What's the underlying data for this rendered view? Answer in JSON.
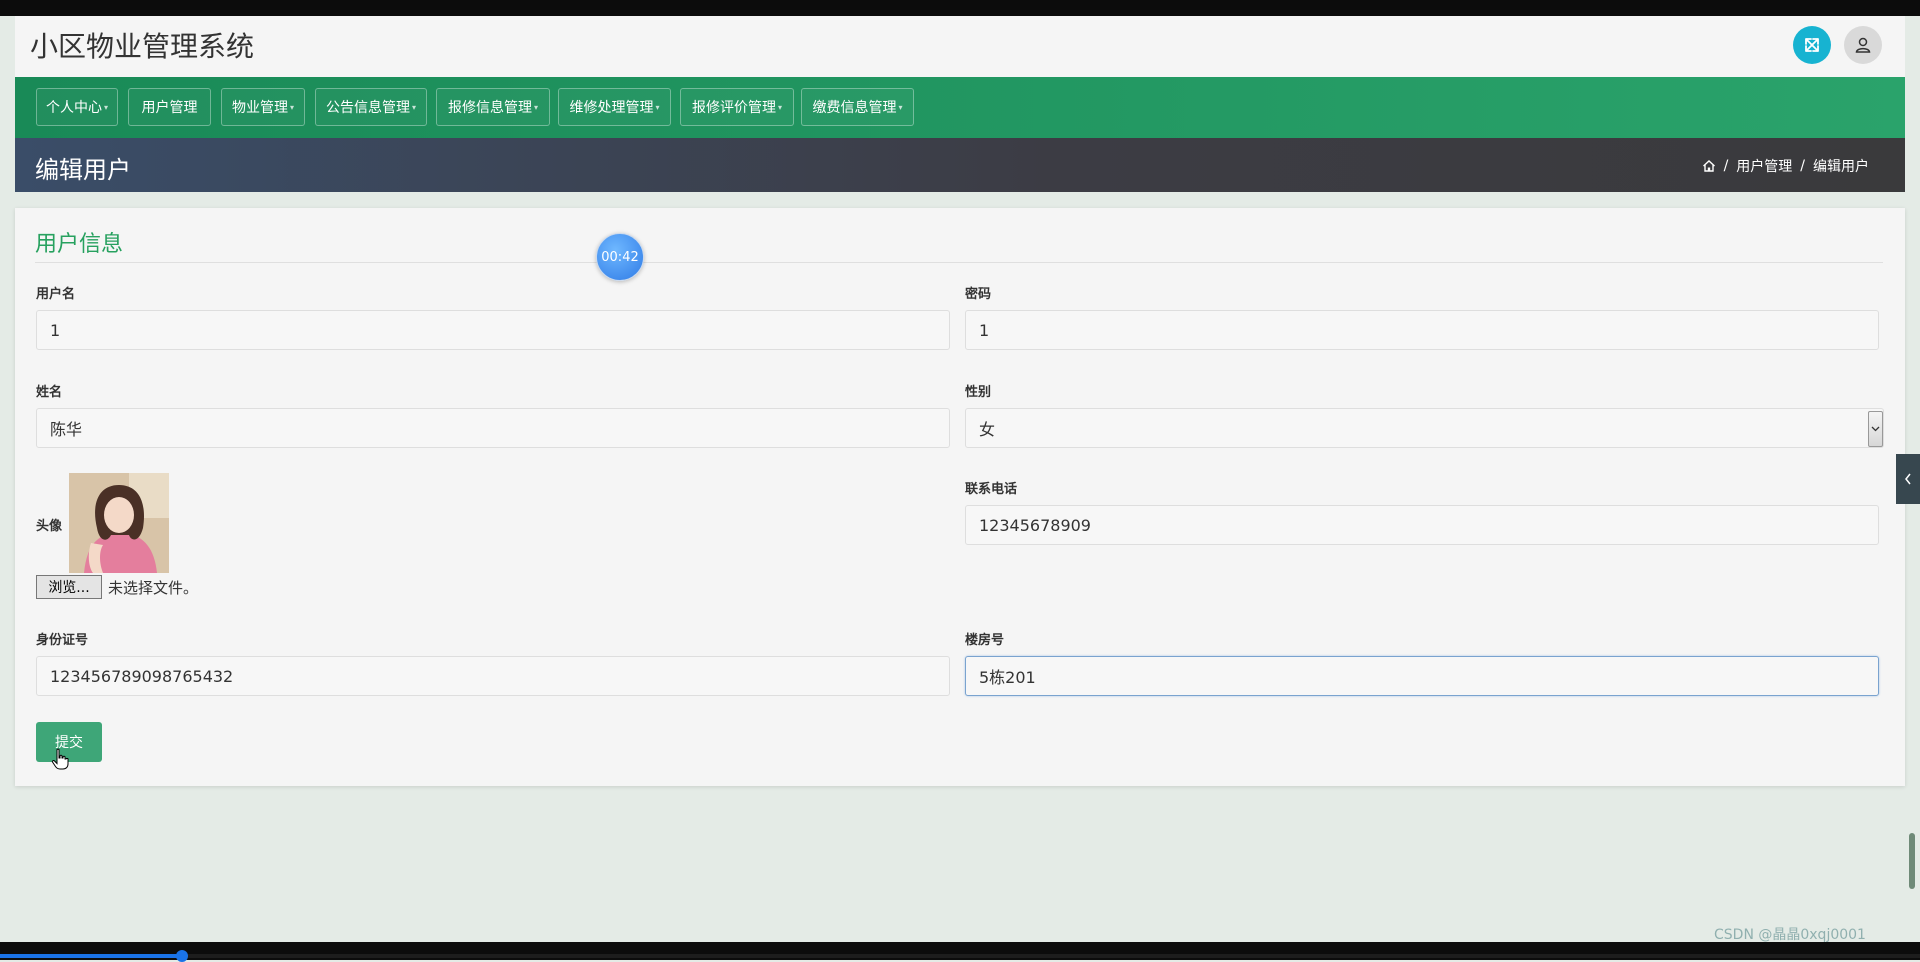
{
  "header": {
    "app_title": "小区物业管理系统",
    "fullscreen_icon": "expand-icon",
    "user_icon": "user-icon"
  },
  "nav": {
    "items": [
      {
        "label": "个人中心",
        "dropdown": true
      },
      {
        "label": "用户管理",
        "dropdown": false
      },
      {
        "label": "物业管理",
        "dropdown": true
      },
      {
        "label": "公告信息管理",
        "dropdown": true
      },
      {
        "label": "报修信息管理",
        "dropdown": true
      },
      {
        "label": "维修处理管理",
        "dropdown": true
      },
      {
        "label": "报修评价管理",
        "dropdown": true
      },
      {
        "label": "缴费信息管理",
        "dropdown": true
      }
    ]
  },
  "titlebar": {
    "page_title": "编辑用户",
    "breadcrumb": {
      "home_icon": "home-icon",
      "separator": "/",
      "level1": "用户管理",
      "level2": "编辑用户"
    }
  },
  "form": {
    "section_title": "用户信息",
    "username": {
      "label": "用户名",
      "value": "1"
    },
    "password": {
      "label": "密码",
      "value": "1"
    },
    "name": {
      "label": "姓名",
      "value": "陈华"
    },
    "gender": {
      "label": "性别",
      "value": "女"
    },
    "avatar": {
      "label": "头像",
      "browse_label": "浏览...",
      "file_status": "未选择文件。"
    },
    "phone": {
      "label": "联系电话",
      "value": "12345678909"
    },
    "id_number": {
      "label": "身份证号",
      "value": "123456789098765432"
    },
    "building": {
      "label": "楼房号",
      "value": "5栋201"
    },
    "submit_label": "提交"
  },
  "overlay": {
    "timer": "00:42",
    "video_progress": 0.095,
    "watermark": "CSDN @晶晶0xqj0001"
  },
  "colors": {
    "nav_green": "#1f9a62",
    "accent_green": "#27a15f",
    "submit_green": "#3ea678",
    "fullscreen_blue": "#17b3d1"
  }
}
